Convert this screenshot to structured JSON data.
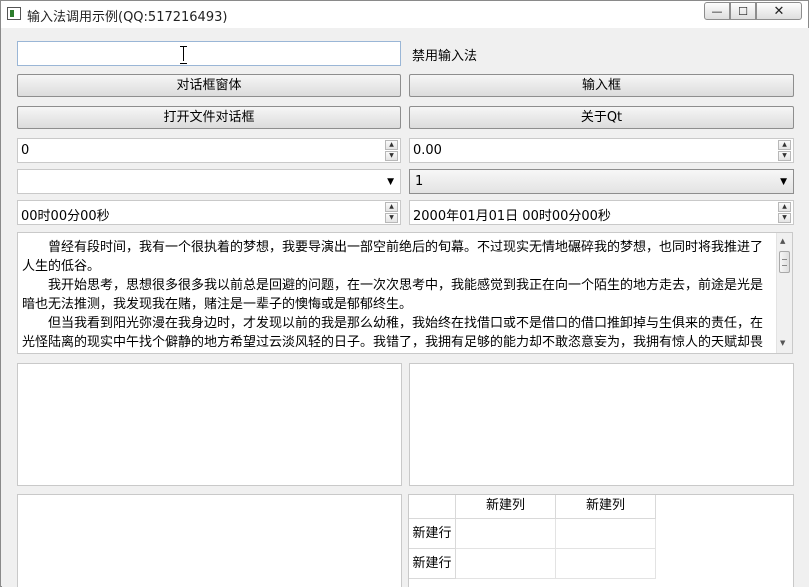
{
  "window": {
    "title": "输入法调用示例(QQ:517216493)",
    "min_symbol": "—",
    "max_symbol": "☐",
    "close_symbol": "✕"
  },
  "row1": {
    "input_value": "",
    "disable_label": "禁用输入法"
  },
  "buttons": {
    "dialog_form": "对话框窗体",
    "input_box": "输入框",
    "open_file_dialog": "打开文件对话框",
    "about_qt": "关于Qt"
  },
  "spinboxes": {
    "int_value": "0",
    "double_value": "0.00",
    "up_arrow": "▲",
    "down_arrow": "▼"
  },
  "combos": {
    "left_value": "",
    "right_value": "1",
    "arrow": "▼"
  },
  "datetimes": {
    "time_value": "00时00分00秒",
    "datetime_value": "2000年01月01日 00时00分00秒"
  },
  "textedit": {
    "paragraphs": [
      "曾经有段时间，我有一个很执着的梦想，我要导演出一部空前绝后的旬幕。不过现实无情地碾碎我的梦想，也同时将我推进了人生的低谷。",
      "我开始思考，思想很多很多我以前总是回避的问题，在一次次思考中，我能感觉到我正在向一个陌生的地方走去，前途是光是暗也无法推测，我发现我在赌，赌注是一辈子的懊悔或是郁郁终生。",
      "但当我看到阳光弥漫在我身边时，才发现以前的我是那么幼稚，我始终在找借口或不是借口的借口推卸掉与生俱来的责任，在光怪陆离的现实中午找个僻静的地方希望过云淡风轻的日子。我错了，我拥有足够的能力却不敢恣意妄为，我拥有惊人的天赋却畏惧"
    ],
    "scroll_up": "▲",
    "scroll_down": "▼"
  },
  "table": {
    "columns": [
      "新建列",
      "新建列"
    ],
    "rows": [
      "新建行",
      "新建行"
    ]
  }
}
